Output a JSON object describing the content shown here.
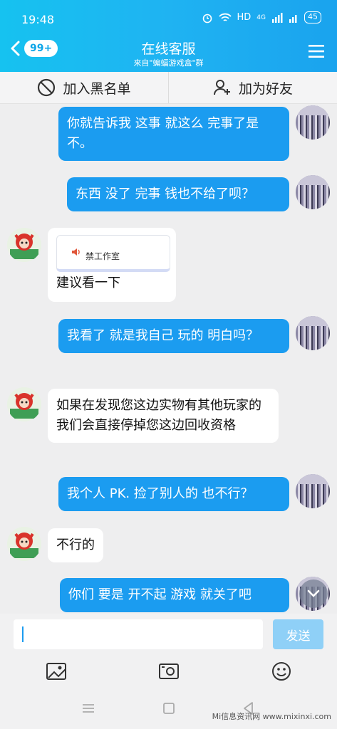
{
  "status": {
    "time": "19:48",
    "network": "HD",
    "signal": "4G",
    "battery": "45"
  },
  "header": {
    "back_badge": "99+",
    "title": "在线客服",
    "subtitle": "来自\"蝙蝠游戏盒\"群"
  },
  "actions": {
    "blacklist": "加入黑名单",
    "add_friend": "加为好友"
  },
  "messages": [
    {
      "from": "me",
      "text": "你就告诉我  这事  就这么  完事了是不。"
    },
    {
      "from": "me",
      "text": "东西  没了  完事  钱也不给了呗？"
    },
    {
      "from": "cs",
      "card_text": "禁工作室",
      "text": "建议看一下"
    },
    {
      "from": "me",
      "text": "我看了  就是我自己  玩的  明白吗？"
    },
    {
      "from": "cs",
      "text": "如果在发现您这边实物有其他玩家的 我们会直接停掉您这边回收资格"
    },
    {
      "from": "me",
      "text": "我个人  PK.  捡了别人的  也不行？"
    },
    {
      "from": "cs",
      "text": "不行的"
    },
    {
      "from": "me",
      "text": "你们  要是  开不起  游戏 就关了吧"
    }
  ],
  "input": {
    "value": "",
    "send_label": "发送"
  },
  "icons": {
    "toolbar": [
      "image-icon",
      "photo-icon",
      "emoji-icon"
    ],
    "nav": [
      "menu-nav-icon",
      "home-nav-icon",
      "back-nav-icon"
    ]
  },
  "watermark": "Mi信息资讯网 www.mixinxi.com",
  "colors": {
    "header": "#1fb3f2",
    "bubble_out": "#1b9cf0",
    "send_disabled": "#8fd0f7"
  }
}
